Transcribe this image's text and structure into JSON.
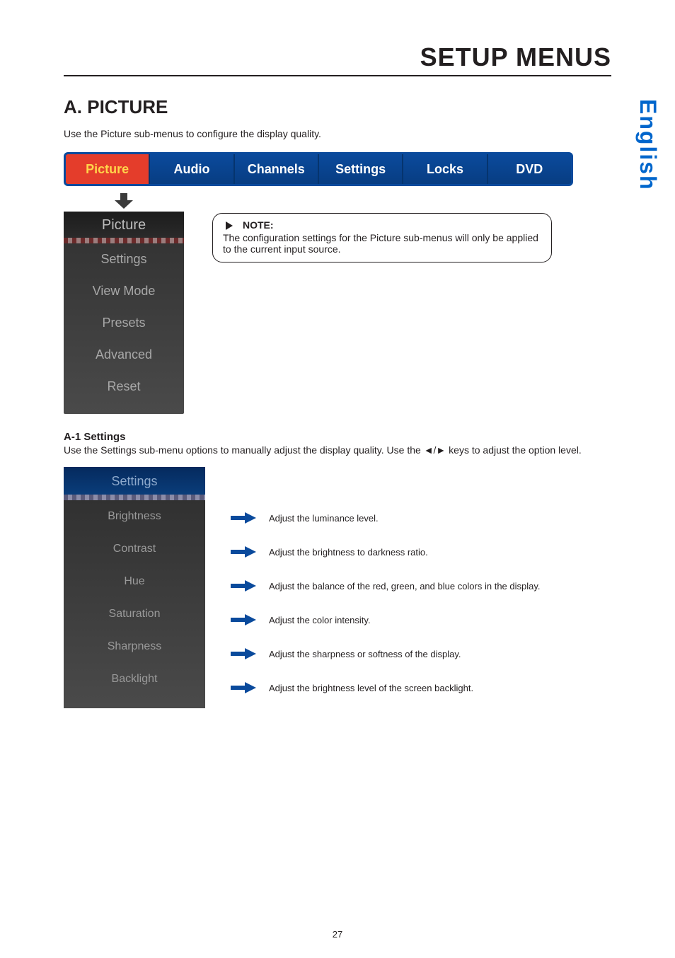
{
  "page": {
    "setup_title": "SETUP MENUS",
    "side_tab": "English",
    "section_title": "A. PICTURE",
    "intro": "Use the Picture sub-menus to configure the display quality.",
    "page_number": "27"
  },
  "menu_bar": {
    "tabs": [
      {
        "label": "Picture",
        "active": true
      },
      {
        "label": "Audio",
        "active": false
      },
      {
        "label": "Channels",
        "active": false
      },
      {
        "label": "Settings",
        "active": false
      },
      {
        "label": "Locks",
        "active": false
      },
      {
        "label": "DVD",
        "active": false
      }
    ]
  },
  "picture_submenu": {
    "header": "Picture",
    "items": [
      "Settings",
      "View Mode",
      "Presets",
      "Advanced",
      "Reset"
    ]
  },
  "note": {
    "lead": "NOTE:",
    "body": "The configuration settings for the Picture sub-menus will only be applied to the current input source."
  },
  "a1": {
    "heading": "A-1  Settings",
    "intro": "Use the Settings sub-menu options to manually adjust the display quality. Use the ◄/► keys to adjust the option level."
  },
  "settings_panel": {
    "header": "Settings",
    "items": [
      {
        "label": "Brightness",
        "desc": "Adjust the luminance level."
      },
      {
        "label": "Contrast",
        "desc": "Adjust the brightness to darkness ratio."
      },
      {
        "label": "Hue",
        "desc": "Adjust the balance of the red, green, and blue colors in the display."
      },
      {
        "label": "Saturation",
        "desc": "Adjust the color intensity."
      },
      {
        "label": "Sharpness",
        "desc": "Adjust the sharpness or softness of the display."
      },
      {
        "label": "Backlight",
        "desc": "Adjust the brightness level of the screen backlight."
      }
    ]
  }
}
